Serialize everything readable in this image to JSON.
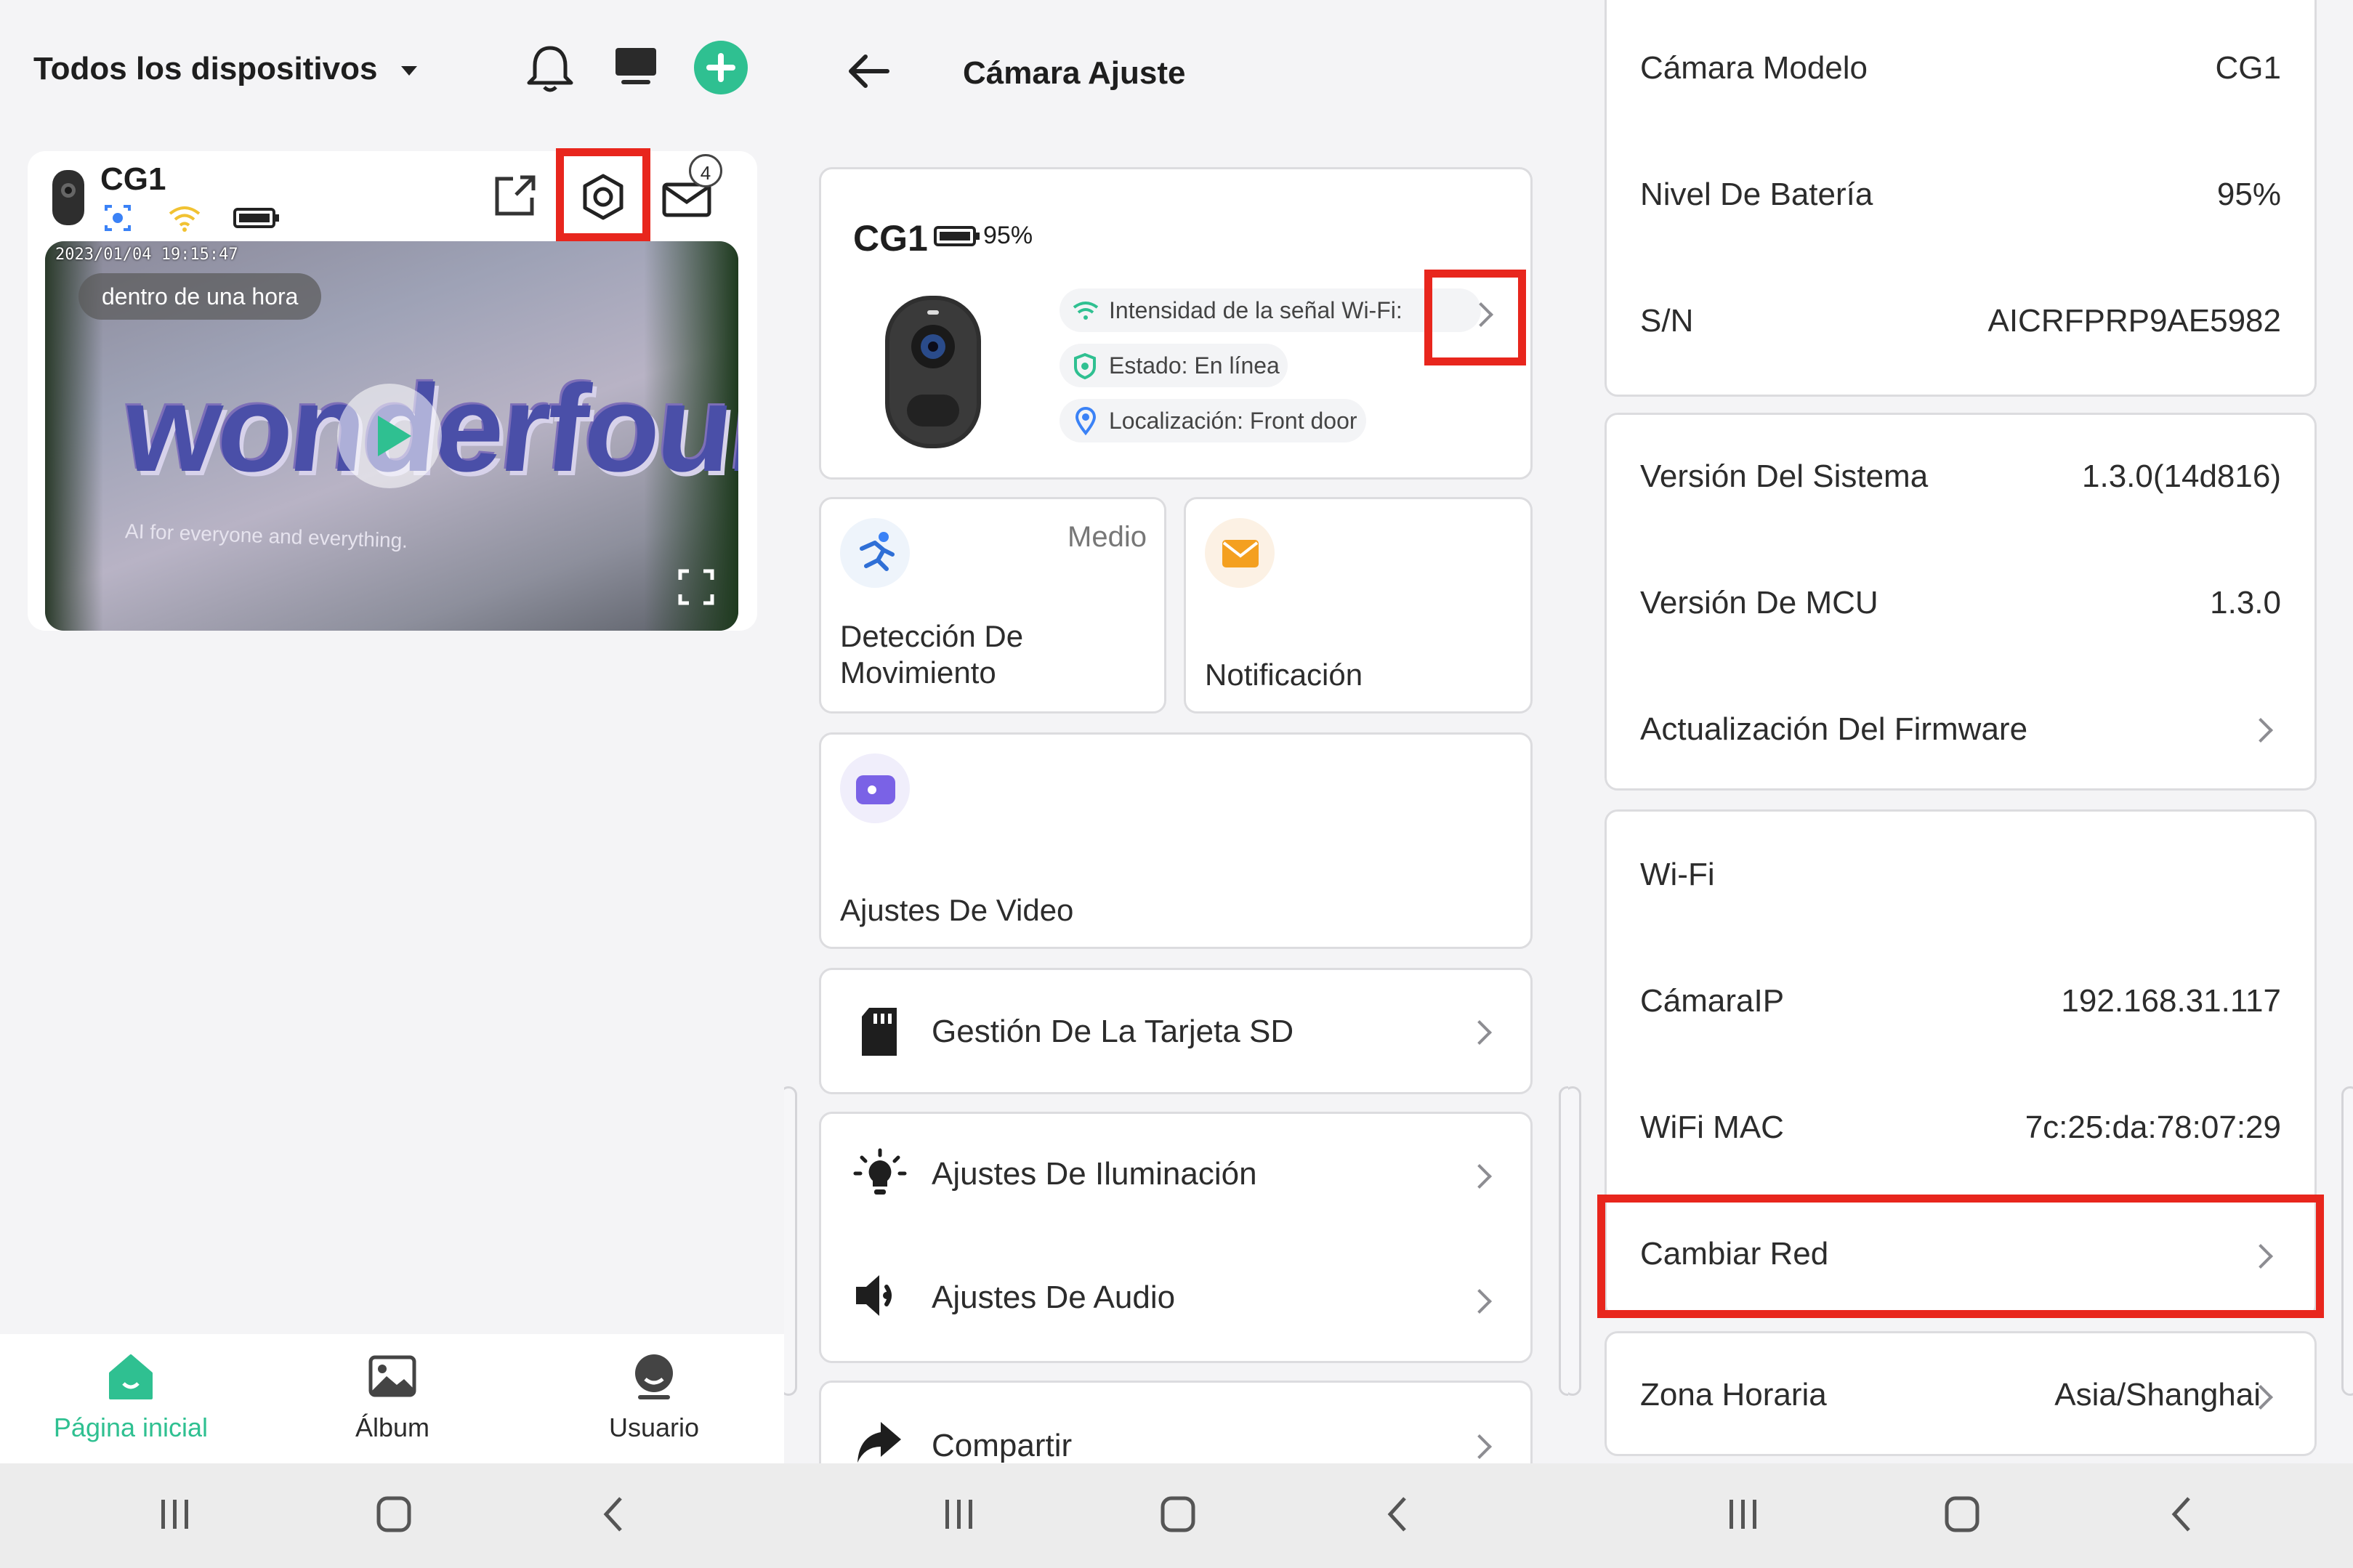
{
  "panel1": {
    "header_title": "Todos los dispositivos",
    "device_name": "CG1",
    "video_timestamp": "2023/01/04  19:15:47",
    "video_time_badge": "dentro de una hora",
    "video_banner_text": "wonderfour",
    "video_slogan": "AI for everyone and everything.",
    "message_count": "4",
    "bottom_nav": [
      {
        "label": "Página inicial",
        "active": true
      },
      {
        "label": "Álbum",
        "active": false
      },
      {
        "label": "Usuario",
        "active": false
      }
    ],
    "accent_color": "#2fc091"
  },
  "panel2": {
    "title": "Cámara Ajuste",
    "device_name": "CG1",
    "battery": "95%",
    "wifi_label": "Intensidad de la señal Wi-Fi:",
    "status_label": "Estado: En línea",
    "location_label": "Localización: Front door",
    "motion_level": "Medio",
    "motion_label": "Detección De Movimiento",
    "notification_label": "Notificación",
    "video_settings_label": "Ajustes De Video",
    "sd_label": "Gestión De La Tarjeta SD",
    "lighting_label": "Ajustes De Iluminación",
    "audio_label": "Ajustes De Audio",
    "share_label": "Compartir"
  },
  "panel3": {
    "model_label": "Cámara Modelo",
    "model_value": "CG1",
    "battery_label": "Nivel De Batería",
    "battery_value": "95%",
    "sn_label": "S/N",
    "sn_value": "AICRFPRP9AE5982",
    "system_version_label": "Versión Del Sistema",
    "system_version_value": "1.3.0(14d816)",
    "mcu_version_label": "Versión De MCU",
    "mcu_version_value": "1.3.0",
    "firmware_label": "Actualización Del Firmware",
    "wifi_label": "Wi-Fi",
    "ip_label": "CámaraIP",
    "ip_value": "192.168.31.117",
    "mac_label": "WiFi MAC",
    "mac_value": "7c:25:da:78:07:29",
    "change_network_label": "Cambiar Red",
    "timezone_label": "Zona Horaria",
    "timezone_value": "Asia/Shanghai"
  }
}
